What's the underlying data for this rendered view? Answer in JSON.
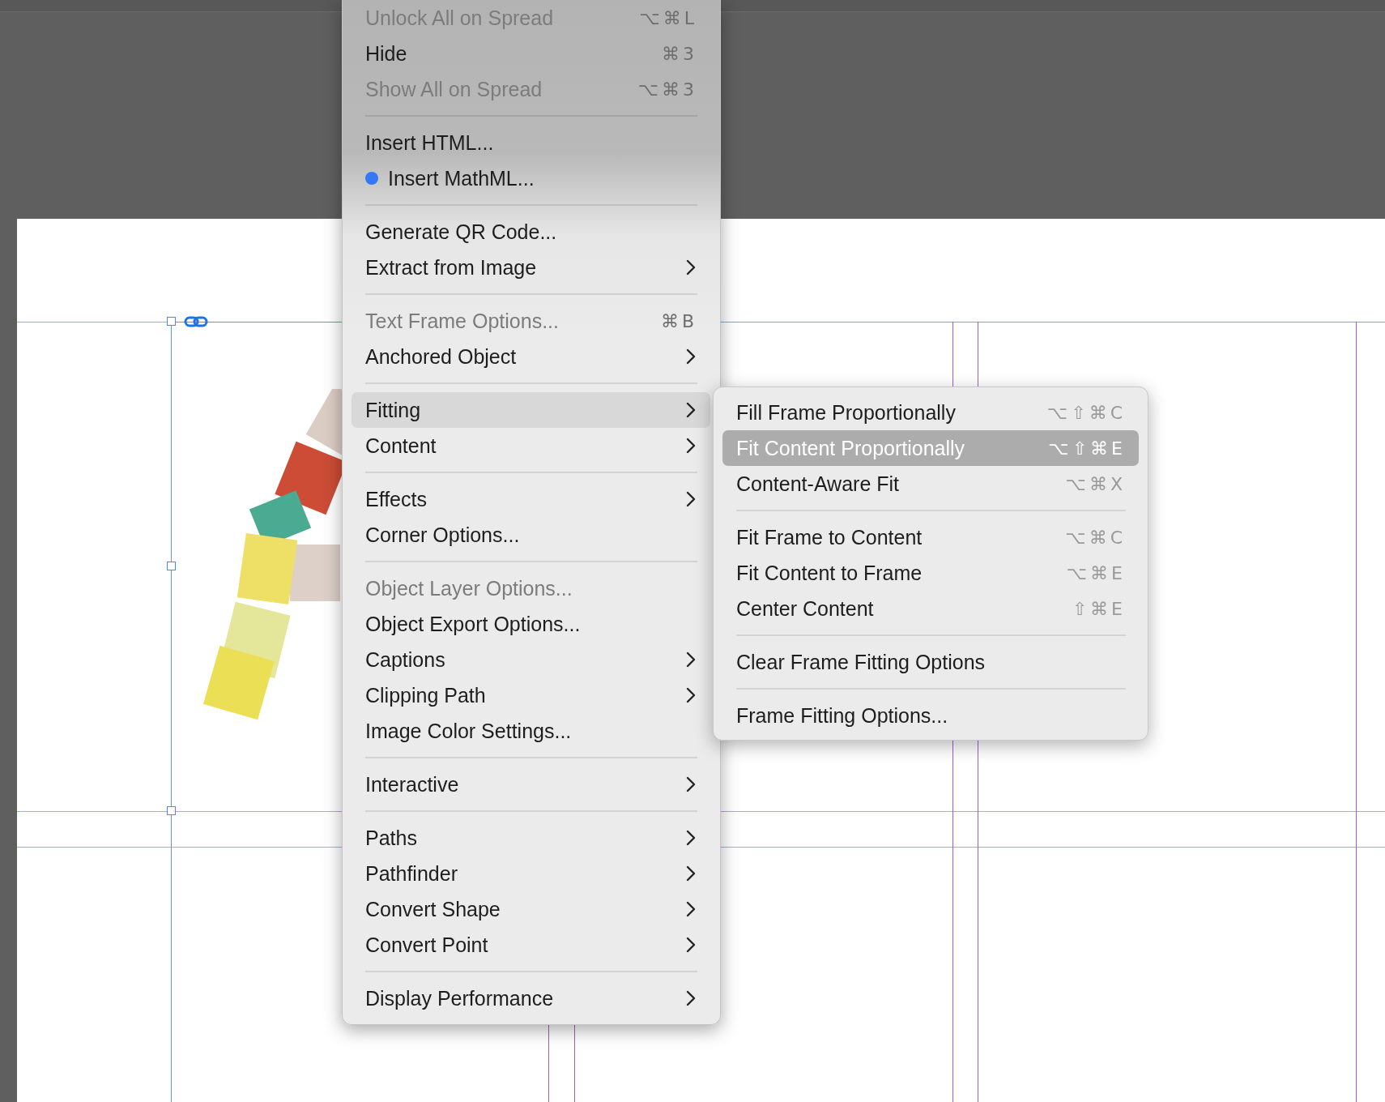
{
  "context_menu": {
    "items": [
      {
        "kind": "item",
        "label": "Unlock All on Spread",
        "shortcut": "⌥⌘L",
        "disabled": true,
        "submenu": false,
        "selected": false,
        "dot": false
      },
      {
        "kind": "item",
        "label": "Hide",
        "shortcut": "⌘3",
        "disabled": false,
        "submenu": false,
        "selected": false,
        "dot": false
      },
      {
        "kind": "item",
        "label": "Show All on Spread",
        "shortcut": "⌥⌘3",
        "disabled": true,
        "submenu": false,
        "selected": false,
        "dot": false
      },
      {
        "kind": "separator"
      },
      {
        "kind": "item",
        "label": "Insert HTML...",
        "disabled": false,
        "submenu": false,
        "selected": false,
        "dot": false
      },
      {
        "kind": "item",
        "label": "Insert MathML...",
        "disabled": false,
        "submenu": false,
        "selected": false,
        "dot": true
      },
      {
        "kind": "separator"
      },
      {
        "kind": "item",
        "label": "Generate QR Code...",
        "disabled": false,
        "submenu": false,
        "selected": false,
        "dot": false
      },
      {
        "kind": "item",
        "label": "Extract from Image",
        "disabled": false,
        "submenu": true,
        "selected": false,
        "dot": false
      },
      {
        "kind": "separator"
      },
      {
        "kind": "item",
        "label": "Text Frame Options...",
        "shortcut": "⌘B",
        "disabled": true,
        "submenu": false,
        "selected": false,
        "dot": false
      },
      {
        "kind": "item",
        "label": "Anchored Object",
        "disabled": false,
        "submenu": true,
        "selected": false,
        "dot": false
      },
      {
        "kind": "separator"
      },
      {
        "kind": "item",
        "label": "Fitting",
        "disabled": false,
        "submenu": true,
        "selected": true,
        "dot": false
      },
      {
        "kind": "item",
        "label": "Content",
        "disabled": false,
        "submenu": true,
        "selected": false,
        "dot": false
      },
      {
        "kind": "separator"
      },
      {
        "kind": "item",
        "label": "Effects",
        "disabled": false,
        "submenu": true,
        "selected": false,
        "dot": false
      },
      {
        "kind": "item",
        "label": "Corner Options...",
        "disabled": false,
        "submenu": false,
        "selected": false,
        "dot": false
      },
      {
        "kind": "separator"
      },
      {
        "kind": "item",
        "label": "Object Layer Options...",
        "disabled": true,
        "submenu": false,
        "selected": false,
        "dot": false
      },
      {
        "kind": "item",
        "label": "Object Export Options...",
        "disabled": false,
        "submenu": false,
        "selected": false,
        "dot": false
      },
      {
        "kind": "item",
        "label": "Captions",
        "disabled": false,
        "submenu": true,
        "selected": false,
        "dot": false
      },
      {
        "kind": "item",
        "label": "Clipping Path",
        "disabled": false,
        "submenu": true,
        "selected": false,
        "dot": false
      },
      {
        "kind": "item",
        "label": "Image Color Settings...",
        "disabled": false,
        "submenu": false,
        "selected": false,
        "dot": false
      },
      {
        "kind": "separator"
      },
      {
        "kind": "item",
        "label": "Interactive",
        "disabled": false,
        "submenu": true,
        "selected": false,
        "dot": false
      },
      {
        "kind": "separator"
      },
      {
        "kind": "item",
        "label": "Paths",
        "disabled": false,
        "submenu": true,
        "selected": false,
        "dot": false
      },
      {
        "kind": "item",
        "label": "Pathfinder",
        "disabled": false,
        "submenu": true,
        "selected": false,
        "dot": false
      },
      {
        "kind": "item",
        "label": "Convert Shape",
        "disabled": false,
        "submenu": true,
        "selected": false,
        "dot": false
      },
      {
        "kind": "item",
        "label": "Convert Point",
        "disabled": false,
        "submenu": true,
        "selected": false,
        "dot": false
      },
      {
        "kind": "separator"
      },
      {
        "kind": "item",
        "label": "Display Performance",
        "disabled": false,
        "submenu": true,
        "selected": false,
        "dot": false
      }
    ]
  },
  "fitting_submenu": {
    "items": [
      {
        "kind": "item",
        "label": "Fill Frame Proportionally",
        "shortcut": "⌥⇧⌘C",
        "selected": false
      },
      {
        "kind": "item",
        "label": "Fit Content Proportionally",
        "shortcut": "⌥⇧⌘E",
        "selected": true
      },
      {
        "kind": "item",
        "label": "Content-Aware Fit",
        "shortcut": "⌥⌘X",
        "selected": false
      },
      {
        "kind": "separator"
      },
      {
        "kind": "item",
        "label": "Fit Frame to Content",
        "shortcut": "⌥⌘C",
        "selected": false
      },
      {
        "kind": "item",
        "label": "Fit Content to Frame",
        "shortcut": "⌥⌘E",
        "selected": false
      },
      {
        "kind": "item",
        "label": "Center Content",
        "shortcut": "⇧⌘E",
        "selected": false
      },
      {
        "kind": "separator"
      },
      {
        "kind": "item",
        "label": "Clear Frame Fitting Options",
        "selected": false
      },
      {
        "kind": "separator"
      },
      {
        "kind": "item",
        "label": "Frame Fitting Options...",
        "selected": false
      }
    ]
  }
}
